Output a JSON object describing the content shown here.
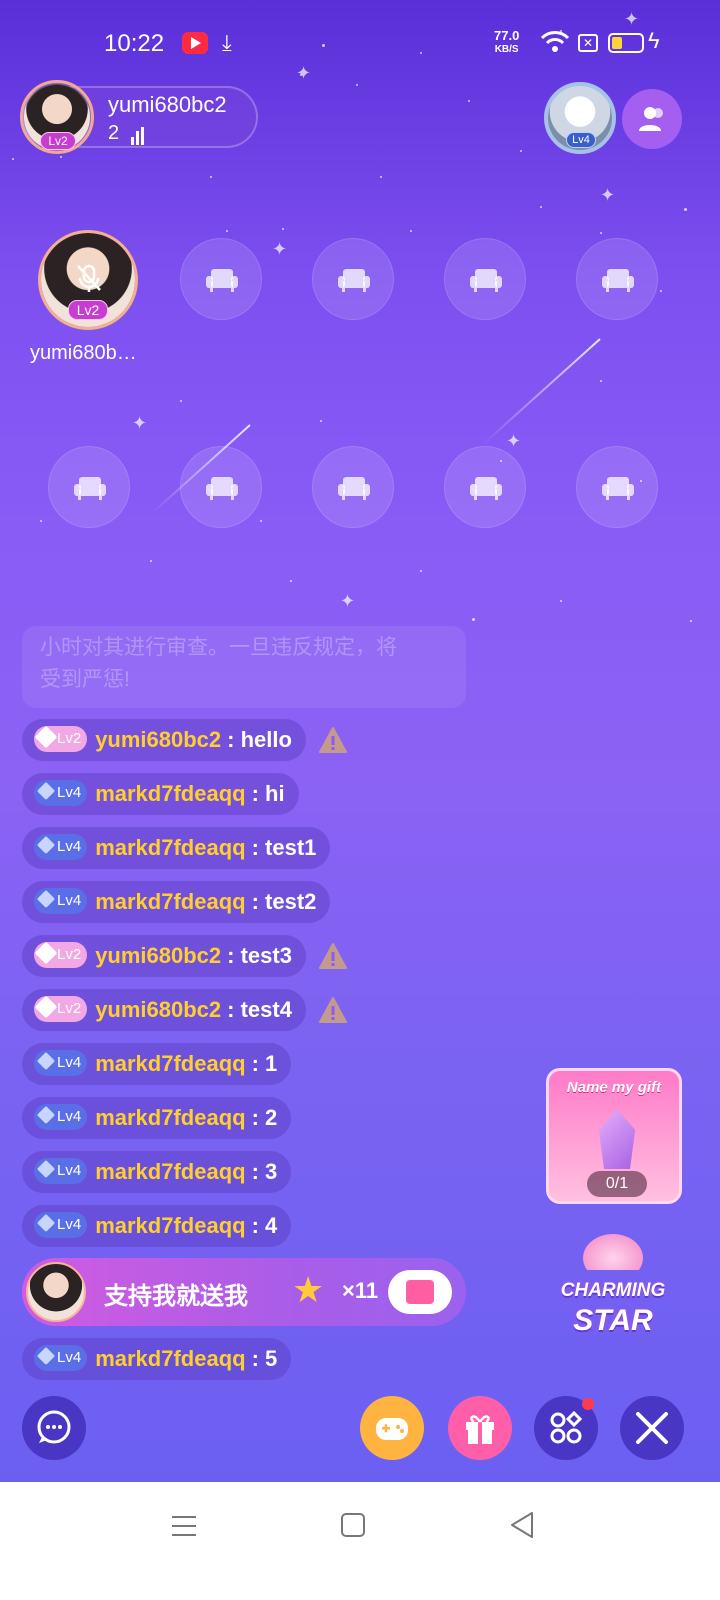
{
  "status_bar": {
    "time": "10:22",
    "net_speed_value": "77.0",
    "net_speed_unit": "KB/S"
  },
  "host": {
    "name": "yumi680bc2",
    "level": "Lv2",
    "listener_count": "2"
  },
  "top_right": {
    "avatar_level": "Lv4"
  },
  "seats": {
    "host_seat_name": "yumi680b…",
    "host_seat_level": "Lv2"
  },
  "notice": {
    "line1": "小时对其进行审查。一旦违反规定，将",
    "line2": "受到严惩!"
  },
  "chat": [
    {
      "level": "Lv2",
      "user": "yumi680bc2",
      "text": ": hello",
      "warning": true
    },
    {
      "level": "Lv4",
      "user": "markd7fdeaqq",
      "text": ": hi",
      "warning": false
    },
    {
      "level": "Lv4",
      "user": "markd7fdeaqq",
      "text": ": test1",
      "warning": false
    },
    {
      "level": "Lv4",
      "user": "markd7fdeaqq",
      "text": ": test2",
      "warning": false
    },
    {
      "level": "Lv2",
      "user": "yumi680bc2",
      "text": ": test3",
      "warning": true
    },
    {
      "level": "Lv2",
      "user": "yumi680bc2",
      "text": ": test4",
      "warning": true
    },
    {
      "level": "Lv4",
      "user": "markd7fdeaqq",
      "text": ": 1",
      "warning": false
    },
    {
      "level": "Lv4",
      "user": "markd7fdeaqq",
      "text": ": 2",
      "warning": false
    },
    {
      "level": "Lv4",
      "user": "markd7fdeaqq",
      "text": ": 3",
      "warning": false
    },
    {
      "level": "Lv4",
      "user": "markd7fdeaqq",
      "text": ": 4",
      "warning": false
    },
    {
      "level": "Lv4",
      "user": "markd7fdeaqq",
      "text": ": 5",
      "warning": false
    }
  ],
  "gift_banner": {
    "text": "支持我就送我",
    "multiplier": "×11"
  },
  "name_my_gift": {
    "title": "Name my gift",
    "progress": "0/1"
  },
  "charming_star": {
    "line1": "CHARMING",
    "line2": "STAR"
  },
  "colors": {
    "username": "#ffcf2f",
    "accent_purple": "#8a5cf6"
  }
}
